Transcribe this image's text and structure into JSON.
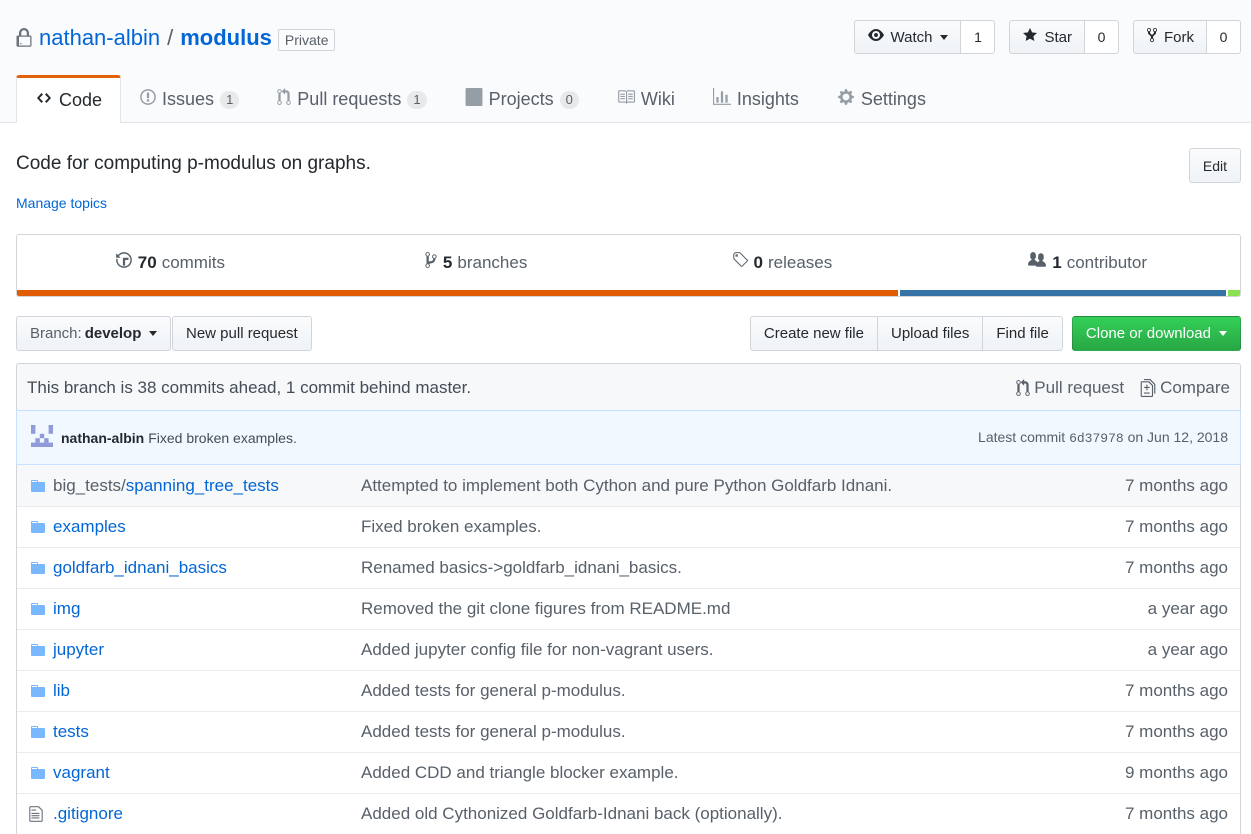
{
  "repo": {
    "owner": "nathan-albin",
    "separator": "/",
    "name": "modulus",
    "visibility": "Private"
  },
  "actions": {
    "watch": {
      "label": "Watch",
      "count": "1"
    },
    "star": {
      "label": "Star",
      "count": "0"
    },
    "fork": {
      "label": "Fork",
      "count": "0"
    }
  },
  "tabs": [
    {
      "label": "Code",
      "icon": "code-icon",
      "selected": true
    },
    {
      "label": "Issues",
      "icon": "issue-icon",
      "count": "1"
    },
    {
      "label": "Pull requests",
      "icon": "pull-request-icon",
      "count": "1"
    },
    {
      "label": "Projects",
      "icon": "project-icon",
      "count": "0"
    },
    {
      "label": "Wiki",
      "icon": "book-icon"
    },
    {
      "label": "Insights",
      "icon": "graph-icon"
    },
    {
      "label": "Settings",
      "icon": "gear-icon"
    }
  ],
  "description": "Code for computing p-modulus on graphs.",
  "edit_label": "Edit",
  "manage_topics": "Manage topics",
  "summary": {
    "commits": {
      "num": "70",
      "label": "commits"
    },
    "branches": {
      "num": "5",
      "label": "branches"
    },
    "releases": {
      "num": "0",
      "label": "releases"
    },
    "contributors": {
      "num": "1",
      "label": "contributor"
    }
  },
  "language_bar": [
    {
      "color": "#e05d06",
      "percent": 73.1
    },
    {
      "color": "#3572a5",
      "percent": 27.2
    },
    {
      "color": "#89e051",
      "percent": 1.2
    }
  ],
  "nav": {
    "branch_prefix": "Branch:",
    "branch_name": "develop",
    "new_pull_request": "New pull request",
    "create_new_file": "Create new file",
    "upload_files": "Upload files",
    "find_file": "Find file",
    "clone_or_download": "Clone or download"
  },
  "branch_info": {
    "text": "This branch is 38 commits ahead, 1 commit behind master.",
    "pull_request": "Pull request",
    "compare": "Compare"
  },
  "latest_commit": {
    "author": "nathan-albin",
    "message": "Fixed broken examples.",
    "prefix": "Latest commit",
    "sha": "6d37978",
    "date": "on Jun 12, 2018"
  },
  "files": [
    {
      "type": "dir",
      "prefix": "big_tests/",
      "name": "spanning_tree_tests",
      "message": "Attempted to implement both Cython and pure Python Goldfarb Idnani.",
      "age": "7 months ago"
    },
    {
      "type": "dir",
      "prefix": "",
      "name": "examples",
      "message": "Fixed broken examples.",
      "age": "7 months ago"
    },
    {
      "type": "dir",
      "prefix": "",
      "name": "goldfarb_idnani_basics",
      "message": "Renamed basics->goldfarb_idnani_basics.",
      "age": "7 months ago"
    },
    {
      "type": "dir",
      "prefix": "",
      "name": "img",
      "message": "Removed the git clone figures from README.md",
      "age": "a year ago"
    },
    {
      "type": "dir",
      "prefix": "",
      "name": "jupyter",
      "message": "Added jupyter config file for non-vagrant users.",
      "age": "a year ago"
    },
    {
      "type": "dir",
      "prefix": "",
      "name": "lib",
      "message": "Added tests for general p-modulus.",
      "age": "7 months ago"
    },
    {
      "type": "dir",
      "prefix": "",
      "name": "tests",
      "message": "Added tests for general p-modulus.",
      "age": "7 months ago"
    },
    {
      "type": "dir",
      "prefix": "",
      "name": "vagrant",
      "message": "Added CDD and triangle blocker example.",
      "age": "9 months ago"
    },
    {
      "type": "file",
      "prefix": "",
      "name": ".gitignore",
      "message": "Added old Cythonized Goldfarb-Idnani back (optionally).",
      "age": "7 months ago"
    }
  ]
}
